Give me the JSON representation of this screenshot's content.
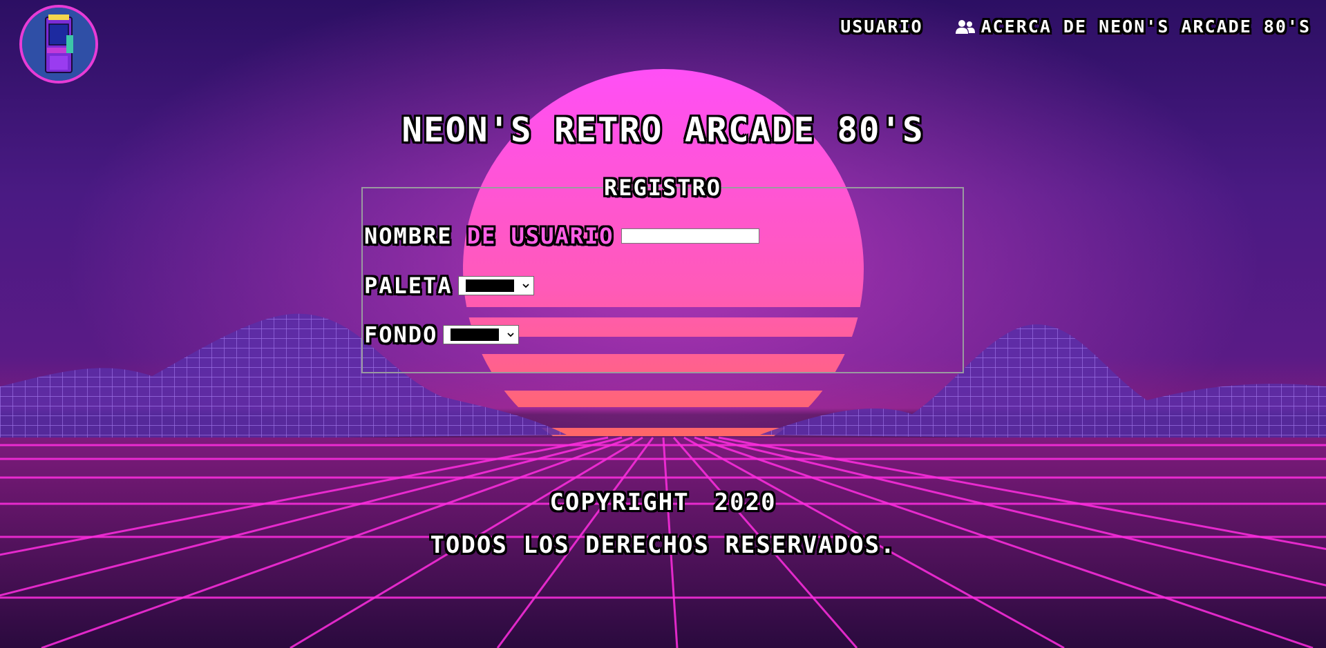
{
  "logo": {
    "alt_text": "NEON'S RETRO 80'S"
  },
  "nav": {
    "user_label": "USUARIO",
    "about_label": "ACERCA DE NEON'S ARCADE 80'S",
    "about_icon": "users-icon"
  },
  "page_title": "NEON'S RETRO ARCADE 80'S",
  "form": {
    "legend": "REGISTRO",
    "username_label_part1": "NOMBRE ",
    "username_label_part2": "DE USUARIO",
    "username_value": "",
    "palette_label": "PALETA",
    "palette_selected": "black",
    "background_label": "FONDO",
    "background_selected": "black"
  },
  "footer": {
    "copyright": "COPYRIGHT",
    "year": "2020",
    "rights": "TODOS LOS DERECHOS RESERVADOS."
  },
  "colors": {
    "accent_pink": "#ff5fe6",
    "grid_pink": "#ff2ee0",
    "sky_top": "#2c0f63",
    "sun_top": "#ff4ff0",
    "sun_bottom": "#ff6a5c"
  }
}
